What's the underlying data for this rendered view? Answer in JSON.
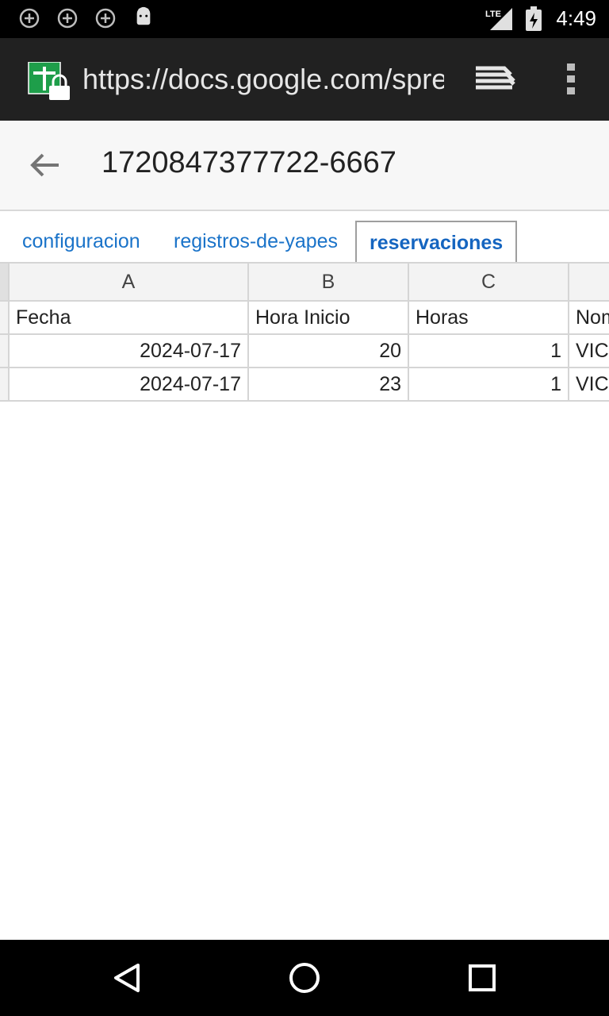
{
  "status_bar": {
    "time": "4:49",
    "icons": [
      "add-circle-icon",
      "add-circle-icon",
      "add-circle-icon",
      "android-icon",
      "lte-signal-icon",
      "battery-charging-icon"
    ],
    "lte_label": "LTE"
  },
  "browser": {
    "url": "https://docs.google.com/spreadsheets",
    "site_icon": "sheets-lock-icon",
    "tabs_icon": "tab-stack-icon",
    "menu_icon": "overflow-menu-icon"
  },
  "doc": {
    "title": "1720847377722-6667",
    "back_icon": "back-arrow-icon"
  },
  "sheet_tabs": [
    {
      "label": "configuracion",
      "active": false
    },
    {
      "label": "registros-de-yapes",
      "active": false
    },
    {
      "label": "reservaciones",
      "active": true
    }
  ],
  "grid": {
    "columns": [
      "A",
      "B",
      "C",
      ""
    ],
    "rows": [
      [
        "Fecha",
        "Hora Inicio",
        "Horas",
        "Nombre"
      ],
      [
        "2024-07-17",
        "20",
        "1",
        "VICTOR"
      ],
      [
        "2024-07-17",
        "23",
        "1",
        "VICTOR"
      ]
    ]
  },
  "nav_bar": {
    "back": "nav-back-icon",
    "home": "nav-home-icon",
    "recents": "nav-recents-icon"
  },
  "colors": {
    "toolbar_bg": "#212121",
    "tab_link": "#1a73c9",
    "sheets_green": "#1e9e4a"
  }
}
